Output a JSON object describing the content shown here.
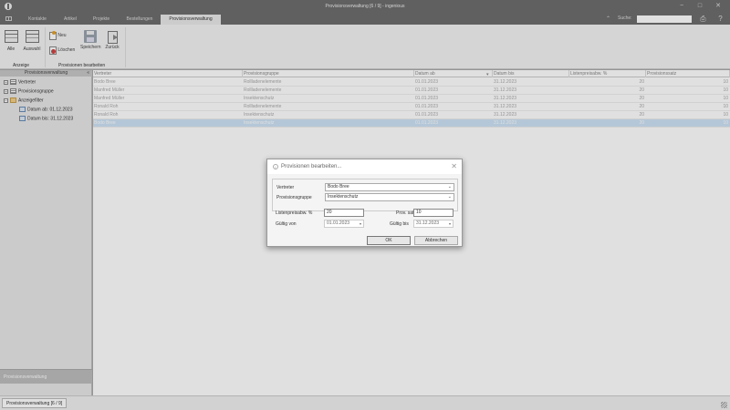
{
  "window": {
    "title": "Provisionsverwaltung [6 / 9] - ingenious",
    "min_glyph": "−",
    "max_glyph": "□",
    "close_glyph": "✕"
  },
  "tabs": [
    {
      "label": "Kontakte"
    },
    {
      "label": "Artikel"
    },
    {
      "label": "Projekte"
    },
    {
      "label": "Bestellungen"
    },
    {
      "label": "Provisionsverwaltung"
    }
  ],
  "search": {
    "label": "Suche:",
    "value": "",
    "collapse_glyph": "⌃",
    "print_glyph": "⎙",
    "help_glyph": "?"
  },
  "ribbon": {
    "alle": "Alle",
    "auswahl": "Auswahl",
    "anzeige_group": "Anzeige",
    "neu": "Neu",
    "loeschen": "Löschen",
    "speichern": "Speichern",
    "zurueck": "Zurück",
    "bearbeiten_group": "Provisionen bearbeiten"
  },
  "sidebar": {
    "header": "Provisionsverwaltung",
    "collapse_glyph": "«",
    "items": [
      {
        "label": "Vertreter",
        "expander": "+"
      },
      {
        "label": "Provisionsgruppe",
        "expander": "+"
      },
      {
        "label": "Anzeigefilter",
        "expander": "−"
      },
      {
        "label": "Datum ab: 01.12.2023"
      },
      {
        "label": "Datum bis: 31.12.2023"
      }
    ],
    "bottom_label": "Provisionsverwaltung"
  },
  "grid": {
    "columns": [
      "Vertreter",
      "Provisionsgruppe",
      "Datum ab",
      "Datum bis",
      "Listenpreisabw. %",
      "Provisionssatz"
    ],
    "sort_glyph": "▾",
    "rows": [
      [
        "Bodo Bree",
        "Rollladenelemente",
        "01.01.2023",
        "31.12.2023",
        "20",
        "10"
      ],
      [
        "Manfred Müller",
        "Rollladenelemente",
        "01.01.2023",
        "31.12.2023",
        "20",
        "10"
      ],
      [
        "Manfred Müller",
        "Insektenschutz",
        "01.01.2023",
        "31.12.2023",
        "20",
        "10"
      ],
      [
        "Ronald Roh",
        "Rollladenelemente",
        "01.01.2023",
        "31.12.2023",
        "20",
        "10"
      ],
      [
        "Ronald Roh",
        "Insektenschutz",
        "01.01.2023",
        "31.12.2023",
        "20",
        "10"
      ],
      [
        "Bodo Bree",
        "Insektenschutz",
        "01.01.2023",
        "31.12.2023",
        "20",
        "10"
      ]
    ],
    "selected_row": 5
  },
  "dialog": {
    "title": "Provisionen bearbeiten...",
    "icon_glyph": "i",
    "close_glyph": "✕",
    "vertreter_label": "Vertreter",
    "vertreter_value": "Bodo Bree",
    "gruppe_label": "Provisionsgruppe",
    "gruppe_value": "Insektenschutz",
    "listenpreis_label": "Listenpreisabw. %",
    "listenpreis_value": "20",
    "provsatz_label": "Prov. satz %",
    "provsatz_value": "10",
    "gueltig_von_label": "Gültig von",
    "gueltig_von_value": "01.01.2023",
    "gueltig_bis_label": "Gültig bis",
    "gueltig_bis_value": "31.12.2023",
    "ok_label": "OK",
    "cancel_label": "Abbrechen",
    "combo_arrow": "⌄",
    "date_arrow": "▾"
  },
  "status": {
    "tab_label": "Provisionsverwaltung [6 / 9]"
  }
}
